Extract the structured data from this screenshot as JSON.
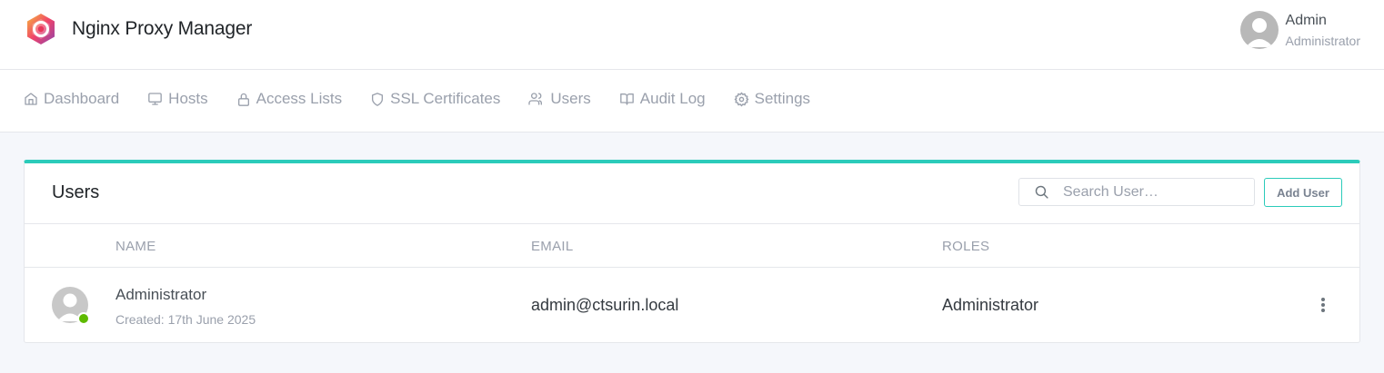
{
  "app": {
    "title": "Nginx Proxy Manager"
  },
  "current_user": {
    "name": "Admin",
    "role": "Administrator"
  },
  "nav": {
    "items": [
      {
        "label": "Dashboard",
        "icon": "home-icon"
      },
      {
        "label": "Hosts",
        "icon": "monitor-icon"
      },
      {
        "label": "Access Lists",
        "icon": "lock-icon"
      },
      {
        "label": "SSL Certificates",
        "icon": "shield-icon"
      },
      {
        "label": "Users",
        "icon": "users-icon"
      },
      {
        "label": "Audit Log",
        "icon": "book-open-icon"
      },
      {
        "label": "Settings",
        "icon": "gear-icon"
      }
    ]
  },
  "users_card": {
    "title": "Users",
    "search_placeholder": "Search User…",
    "add_button_label": "Add User",
    "columns": [
      "NAME",
      "EMAIL",
      "ROLES"
    ],
    "rows": [
      {
        "name": "Administrator",
        "created": "Created: 17th June 2025",
        "email": "admin@ctsurin.local",
        "roles": "Administrator",
        "status": "online"
      }
    ]
  },
  "colors": {
    "accent": "#2bcbba",
    "status_online": "#5eba00",
    "muted_text": "#9aa0ac",
    "page_background": "#f5f7fb"
  }
}
